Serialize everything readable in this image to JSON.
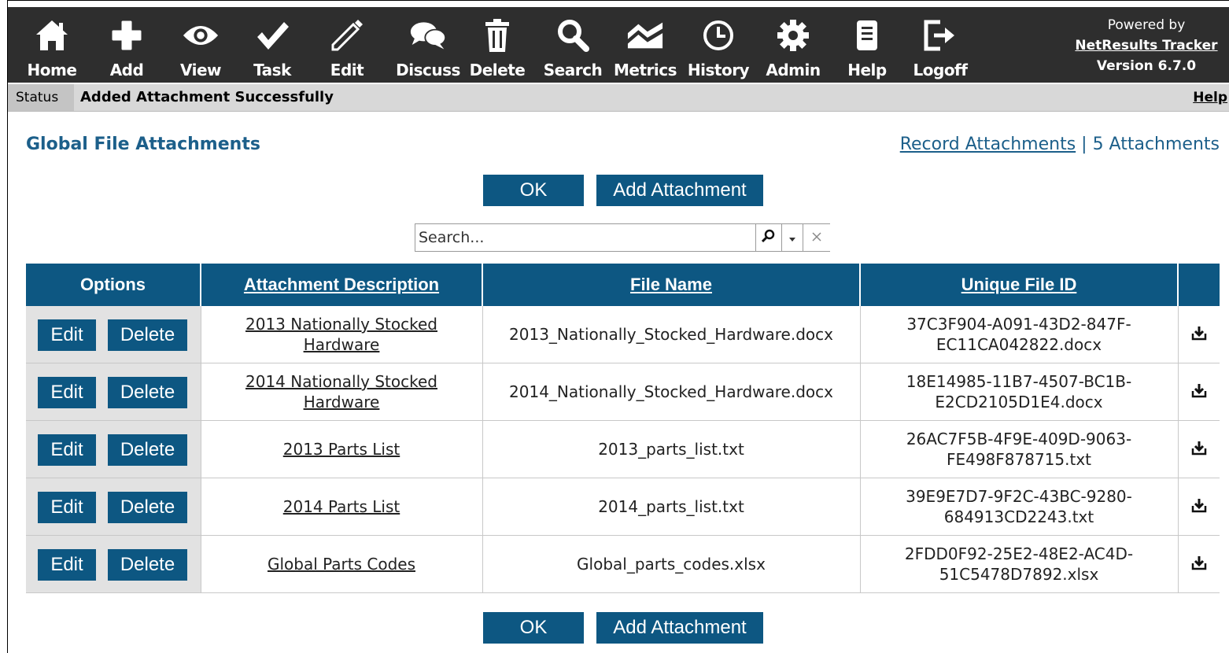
{
  "toolbar": {
    "items": [
      {
        "label": "Home",
        "icon": "home-icon"
      },
      {
        "label": "Add",
        "icon": "plus-icon"
      },
      {
        "label": "View",
        "icon": "eye-icon"
      },
      {
        "label": "Task",
        "icon": "check-icon"
      },
      {
        "label": "Edit",
        "icon": "pencil-icon"
      },
      {
        "label": "Discuss",
        "icon": "chat-icon"
      },
      {
        "label": "Delete",
        "icon": "trash-icon"
      },
      {
        "label": "Search",
        "icon": "magnifier-icon"
      },
      {
        "label": "Metrics",
        "icon": "chart-icon"
      },
      {
        "label": "History",
        "icon": "clock-icon"
      },
      {
        "label": "Admin",
        "icon": "gear-icon"
      },
      {
        "label": "Help",
        "icon": "document-icon"
      },
      {
        "label": "Logoff",
        "icon": "logout-icon"
      }
    ],
    "powered_by": "Powered by",
    "product_link": "NetResults Tracker",
    "version": "Version 6.7.0"
  },
  "status": {
    "label": "Status",
    "message": "Added Attachment Successfully",
    "help": "Help"
  },
  "page": {
    "title": "Global File Attachments",
    "record_attachments_link": "Record Attachments",
    "separator": " | ",
    "count_text": "5 Attachments"
  },
  "actions": {
    "ok_label": "OK",
    "add_label": "Add Attachment"
  },
  "search": {
    "placeholder": "Search..."
  },
  "table": {
    "headers": {
      "options": "Options",
      "description": "Attachment Description",
      "file_name": "File Name",
      "unique_id": "Unique File ID"
    },
    "edit_label": "Edit",
    "delete_label": "Delete",
    "rows": [
      {
        "desc1": "2013 Nationally Stocked",
        "desc2": "Hardware",
        "file": "2013_Nationally_Stocked_Hardware.docx",
        "id1": "37C3F904-A091-43D2-847F-",
        "id2": "EC11CA042822.docx"
      },
      {
        "desc1": "2014 Nationally Stocked",
        "desc2": "Hardware",
        "file": "2014_Nationally_Stocked_Hardware.docx",
        "id1": "18E14985-11B7-4507-BC1B-",
        "id2": "E2CD2105D1E4.docx"
      },
      {
        "desc1": "2013 Parts List",
        "desc2": "",
        "file": "2013_parts_list.txt",
        "id1": "26AC7F5B-4F9E-409D-9063-",
        "id2": "FE498F878715.txt"
      },
      {
        "desc1": "2014 Parts List",
        "desc2": "",
        "file": "2014_parts_list.txt",
        "id1": "39E9E7D7-9F2C-43BC-9280-",
        "id2": "684913CD2243.txt"
      },
      {
        "desc1": "Global Parts Codes",
        "desc2": "",
        "file": "Global_parts_codes.xlsx",
        "id1": "2FDD0F92-25E2-48E2-AC4D-",
        "id2": "51C5478D7892.xlsx"
      }
    ]
  },
  "colors": {
    "toolbar_bg": "#2e2e2e",
    "accent": "#0d5782",
    "title": "#1c5f8a",
    "status_bg": "#d8d8d8"
  }
}
